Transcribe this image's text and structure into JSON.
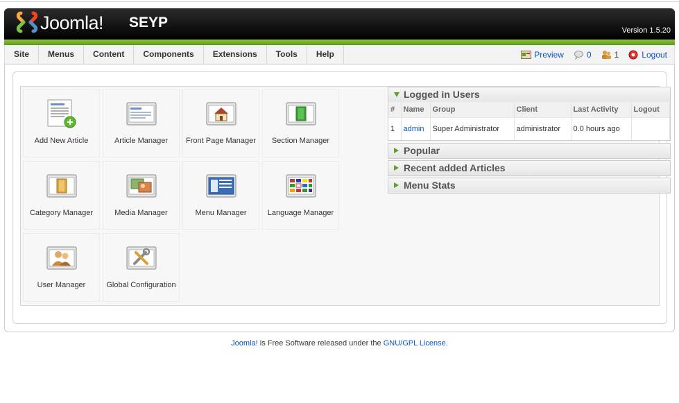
{
  "header": {
    "logo_text": "Joomla!",
    "site_title": "SEYP",
    "version": "Version 1.5.20"
  },
  "menu": [
    {
      "label": "Site",
      "name": "menu-site"
    },
    {
      "label": "Menus",
      "name": "menu-menus"
    },
    {
      "label": "Content",
      "name": "menu-content"
    },
    {
      "label": "Components",
      "name": "menu-components"
    },
    {
      "label": "Extensions",
      "name": "menu-extensions"
    },
    {
      "label": "Tools",
      "name": "menu-tools"
    },
    {
      "label": "Help",
      "name": "menu-help"
    }
  ],
  "status": {
    "preview_label": "Preview",
    "messages_count": "0",
    "users_count": "1",
    "logout_label": "Logout"
  },
  "quickicons": [
    {
      "label": "Add New Article",
      "icon": "add-article-icon"
    },
    {
      "label": "Article Manager",
      "icon": "article-manager-icon"
    },
    {
      "label": "Front Page Manager",
      "icon": "frontpage-icon"
    },
    {
      "label": "Section Manager",
      "icon": "section-icon"
    },
    {
      "label": "Category Manager",
      "icon": "category-icon"
    },
    {
      "label": "Media Manager",
      "icon": "media-icon"
    },
    {
      "label": "Menu Manager",
      "icon": "menu-manager-icon"
    },
    {
      "label": "Language Manager",
      "icon": "language-icon"
    },
    {
      "label": "User Manager",
      "icon": "user-manager-icon"
    },
    {
      "label": "Global Configuration",
      "icon": "config-icon"
    }
  ],
  "panels": {
    "logged_in": {
      "title": "Logged in Users",
      "columns": [
        "#",
        "Name",
        "Group",
        "Client",
        "Last Activity",
        "Logout"
      ],
      "rows": [
        {
          "num": "1",
          "name": "admin",
          "group": "Super Administrator",
          "client": "administrator",
          "last_activity": "0.0 hours ago",
          "logout": ""
        }
      ]
    },
    "popular": {
      "title": "Popular"
    },
    "recent": {
      "title": "Recent added Articles"
    },
    "menu_stats": {
      "title": "Menu Stats"
    }
  },
  "footer": {
    "joomla_link": "Joomla!",
    "text": " is Free Software released under the ",
    "license_link": "GNU/GPL License",
    "end": "."
  },
  "colors": {
    "accent_green": "#5ba22a",
    "link_blue": "#0b55c4",
    "header_black": "#000000"
  }
}
